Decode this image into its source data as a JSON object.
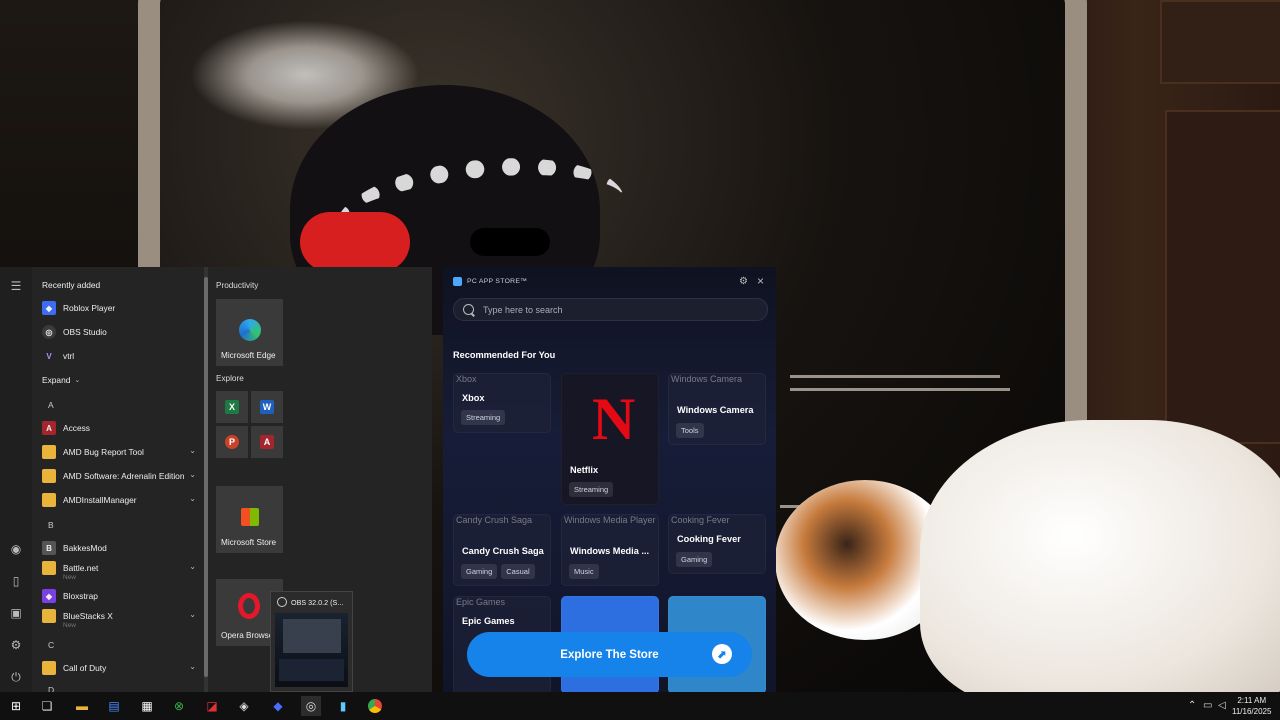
{
  "start_menu": {
    "recently_added_title": "Recently added",
    "recent_items": [
      {
        "label": "Roblox Player",
        "icon": "roblox-icon"
      },
      {
        "label": "OBS Studio",
        "icon": "obs-icon"
      },
      {
        "label": "vtrl",
        "icon": "vtrl-icon"
      }
    ],
    "expand_label": "Expand",
    "letters": [
      "A",
      "B",
      "C",
      "D"
    ],
    "apps": [
      {
        "label": "Access",
        "sub": "",
        "folder": false
      },
      {
        "label": "AMD Bug Report Tool",
        "sub": "",
        "folder": true
      },
      {
        "label": "AMD Software: Adrenalin Edition",
        "sub": "",
        "folder": true
      },
      {
        "label": "AMDInstallManager",
        "sub": "",
        "folder": true
      },
      {
        "label": "BakkesMod",
        "sub": "",
        "folder": false
      },
      {
        "label": "Battle.net",
        "sub": "New",
        "folder": true
      },
      {
        "label": "Bloxstrap",
        "sub": "",
        "folder": false
      },
      {
        "label": "BlueStacks X",
        "sub": "New",
        "folder": true
      },
      {
        "label": "Call of Duty",
        "sub": "",
        "folder": true
      }
    ],
    "groups": {
      "productivity": "Productivity",
      "explore": "Explore"
    },
    "tiles": {
      "edge": "Microsoft Edge",
      "store": "Microsoft Store",
      "opera": "Opera Browse",
      "excel": "X",
      "word": "W",
      "powerpoint": "P",
      "access": "A"
    },
    "obs_preview_title": "OBS 32.0.2 (S..."
  },
  "app_store": {
    "title": "PC APP STORE™",
    "search_placeholder": "Type here to search",
    "recommended_title": "Recommended For You",
    "cards": {
      "xbox": {
        "alt": "Xbox",
        "name": "Xbox",
        "tags": [
          "Streaming"
        ]
      },
      "netflix": {
        "name": "Netflix",
        "tags": [
          "Streaming"
        ]
      },
      "camera": {
        "alt": "Windows Camera",
        "name": "Windows Camera",
        "tags": [
          "Tools"
        ]
      },
      "candy": {
        "alt": "Candy Crush Saga",
        "name": "Candy Crush Saga",
        "tags": [
          "Gaming",
          "Casual"
        ]
      },
      "media": {
        "alt": "Windows Media Player",
        "name": "Windows Media ...",
        "tags": [
          "Music"
        ]
      },
      "cooking": {
        "alt": "Cooking Fever",
        "name": "Cooking Fever",
        "tags": [
          "Gaming"
        ]
      },
      "epic": {
        "alt": "Epic Games",
        "name": "Epic Games"
      }
    },
    "cta_label": "Explore The Store"
  },
  "taskbar": {
    "time": "2:11 AM",
    "date": "11/16/2025"
  },
  "colors": {
    "accent": "#1683ea",
    "netflix_red": "#e50914",
    "folder_yellow": "#e9b43b"
  }
}
